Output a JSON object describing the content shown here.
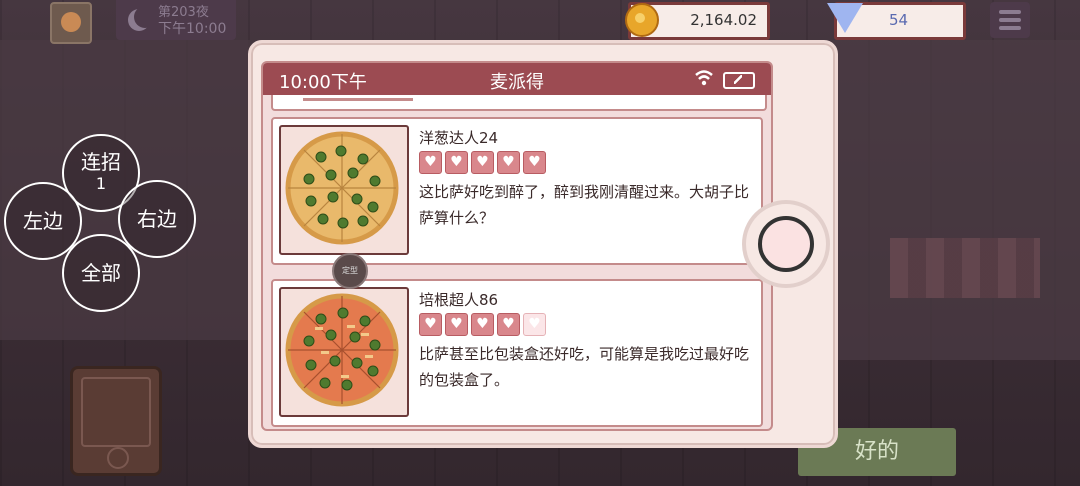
{
  "hud": {
    "night_label": "第203夜",
    "night_time": "下午10:00",
    "coins": "2,164.02",
    "gems": "54"
  },
  "combo": {
    "combo_label": "连招",
    "combo_count": "1",
    "left": "左边",
    "right": "右边",
    "all": "全部"
  },
  "phone": {
    "time": "10:00下午",
    "app_title": "麦派得",
    "pin_badge": "定型",
    "reviews": [
      {
        "name": "洋葱达人24",
        "hearts_filled": 5,
        "hearts_total": 5,
        "comment": "这比萨好吃到醉了，醉到我刚清醒过来。大胡子比萨算什么？"
      },
      {
        "name": "培根超人86",
        "hearts_filled": 4,
        "hearts_total": 5,
        "comment": "比萨甚至比包装盒还好吃，可能算是我吃过最好吃的包装盒了。"
      }
    ]
  },
  "ok_button": "好的",
  "colors": {
    "header": "#9c4b52",
    "heart_filled": "#d9878c",
    "heart_empty": "#fbe6e8"
  }
}
